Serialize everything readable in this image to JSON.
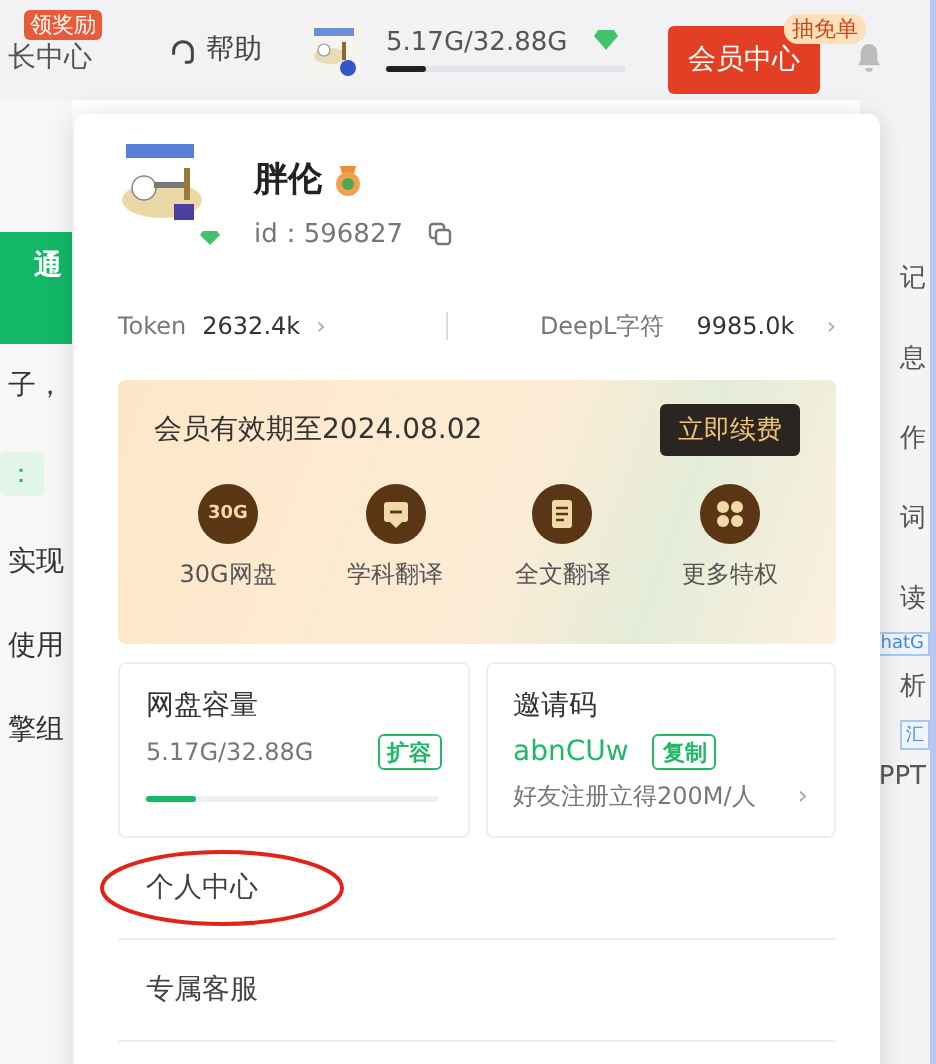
{
  "top_bar": {
    "growth": {
      "label": "长中心",
      "badge": "领奖励"
    },
    "help": "帮助",
    "storage": {
      "text": "5.17G/32.88G",
      "level": 0.17
    },
    "member": {
      "label": "会员中心",
      "badge": "抽免单"
    }
  },
  "background": {
    "left": [
      {
        "kind": "green",
        "text": "通"
      },
      {
        "kind": "text",
        "text": "子，"
      },
      {
        "kind": "pill",
        "text": "："
      },
      {
        "kind": "text",
        "text": "实现"
      },
      {
        "kind": "text",
        "text": "使用"
      },
      {
        "kind": "text",
        "text": "擎组"
      }
    ],
    "right": [
      {
        "kind": "text",
        "text": "记"
      },
      {
        "kind": "text",
        "text": "息"
      },
      {
        "kind": "text",
        "text": "作"
      },
      {
        "kind": "text",
        "text": "词"
      },
      {
        "kind": "text",
        "text": "读"
      },
      {
        "kind": "tag",
        "text": "hatG"
      },
      {
        "kind": "text",
        "text": "析"
      },
      {
        "kind": "tag",
        "text": "汇"
      },
      {
        "kind": "text",
        "text": "PPT"
      }
    ]
  },
  "menu": {
    "user": {
      "name": "胖伦",
      "id": "id：596827"
    },
    "quotas": [
      {
        "label": "Token",
        "value": "2632.4k",
        "chevron": "›"
      },
      {
        "label": "DeepL字符",
        "value": "9985.0k",
        "chevron": "›"
      }
    ],
    "membership": {
      "expiry": "会员有效期至2024.08.02",
      "renew": "立即续费",
      "perks": [
        {
          "kind": "storage",
          "icon_text": "30G",
          "label": "30G网盘"
        },
        {
          "kind": "translate",
          "label": "学科翻译"
        },
        {
          "kind": "document",
          "label": "全文翻译"
        },
        {
          "kind": "more",
          "label": "更多特权"
        }
      ]
    },
    "disk": {
      "title": "网盘容量",
      "usage": "5.17G/32.88G",
      "action": "扩容",
      "level": 0.17
    },
    "invite": {
      "title": "邀请码",
      "code": "abnCUw",
      "action": "复制",
      "hint": "好友注册立得200M/人",
      "chevron": "›"
    },
    "items": [
      {
        "label": "个人中心",
        "circled": true
      },
      {
        "label": "专属客服",
        "circled": false
      }
    ]
  }
}
